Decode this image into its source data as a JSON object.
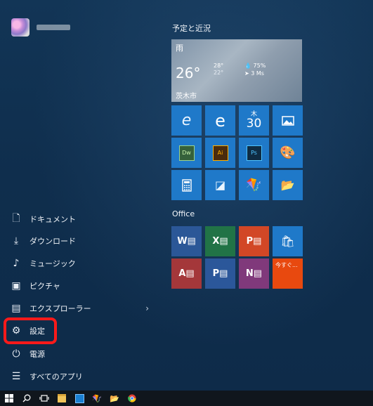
{
  "start_menu": {
    "user": {
      "name": ""
    },
    "left_menu": {
      "items": [
        {
          "label": "ドキュメント",
          "icon": "document-icon"
        },
        {
          "label": "ダウンロード",
          "icon": "download-icon"
        },
        {
          "label": "ミュージック",
          "icon": "music-icon"
        },
        {
          "label": "ピクチャ",
          "icon": "pictures-icon"
        },
        {
          "label": "エクスプローラー",
          "icon": "file-explorer-icon",
          "has_submenu": true
        },
        {
          "label": "設定",
          "icon": "gear-icon",
          "highlighted": true
        },
        {
          "label": "電源",
          "icon": "power-icon"
        },
        {
          "label": "すべてのアプリ",
          "icon": "all-apps-icon"
        }
      ]
    },
    "groups": [
      {
        "title": "予定と近況"
      },
      {
        "title": "Office"
      }
    ],
    "weather": {
      "condition": "雨",
      "temp": "26°",
      "high": "28°",
      "low": "22°",
      "humidity": "75%",
      "wind": "3 Ms",
      "city": "茨木市"
    },
    "calendar_tile": {
      "day": "木",
      "date": "30"
    },
    "office_tiles": {
      "get_office_label": "今すぐ..."
    }
  },
  "colors": {
    "tile_blue": "#1f79c9",
    "word": "#2b5797",
    "excel": "#217346",
    "powerpoint": "#d24726",
    "store": "#1f79c9",
    "access": "#a4373a",
    "project": "#2b579a",
    "onenote": "#80397b",
    "get_office": "#e8490f",
    "highlight_border": "#ff1a1a"
  }
}
